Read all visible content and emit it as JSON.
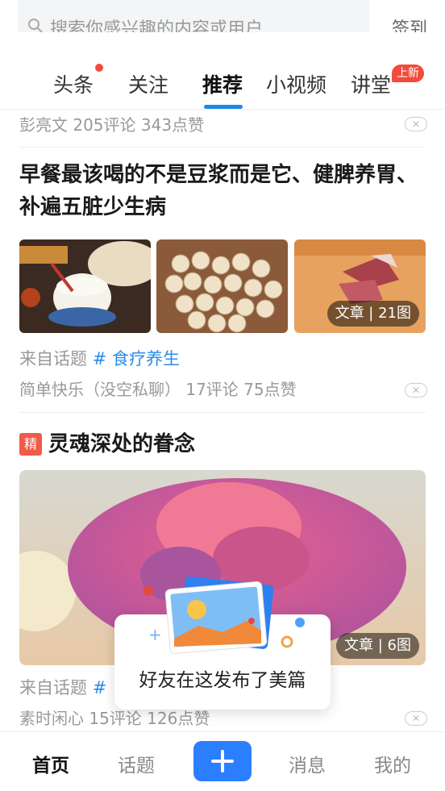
{
  "search": {
    "placeholder": "搜索你感兴趣的内容或用户",
    "signin_label": "签到"
  },
  "tabs": [
    {
      "label": "头条",
      "has_dot": true
    },
    {
      "label": "关注"
    },
    {
      "label": "推荐",
      "active": true
    },
    {
      "label": "小视频"
    },
    {
      "label": "讲堂",
      "badge": "上新"
    }
  ],
  "feed": {
    "top_item": {
      "author": "彭亮文",
      "comments": "205评论",
      "likes": "343点赞"
    },
    "article1": {
      "title": "早餐最该喝的不是豆浆而是它、健脾养胃、补遍五脏少生病",
      "image_badge_type": "文章",
      "image_badge_count": "21图",
      "topic_prefix": "来自话题",
      "topic": "# 食疗养生",
      "author": "简单快乐（没空私聊）",
      "comments": "17评论",
      "likes": "75点赞"
    },
    "article2": {
      "featured_label": "精",
      "title": "灵魂深处的眷念",
      "image_badge_type": "文章",
      "image_badge_count": "6图",
      "topic_prefix": "来自话题",
      "topic": "#",
      "author": "素时闲心",
      "comments": "15评论",
      "likes": "126点赞"
    }
  },
  "popup": {
    "text": "好友在这发布了美篇"
  },
  "bottom_nav": [
    {
      "label": "首页",
      "active": true
    },
    {
      "label": "话题"
    },
    {
      "label": "消息"
    },
    {
      "label": "我的"
    }
  ],
  "colors": {
    "accent": "#1e88e5",
    "red": "#f24b3e",
    "topic": "#2b8ce8",
    "plus": "#2b7fff"
  }
}
